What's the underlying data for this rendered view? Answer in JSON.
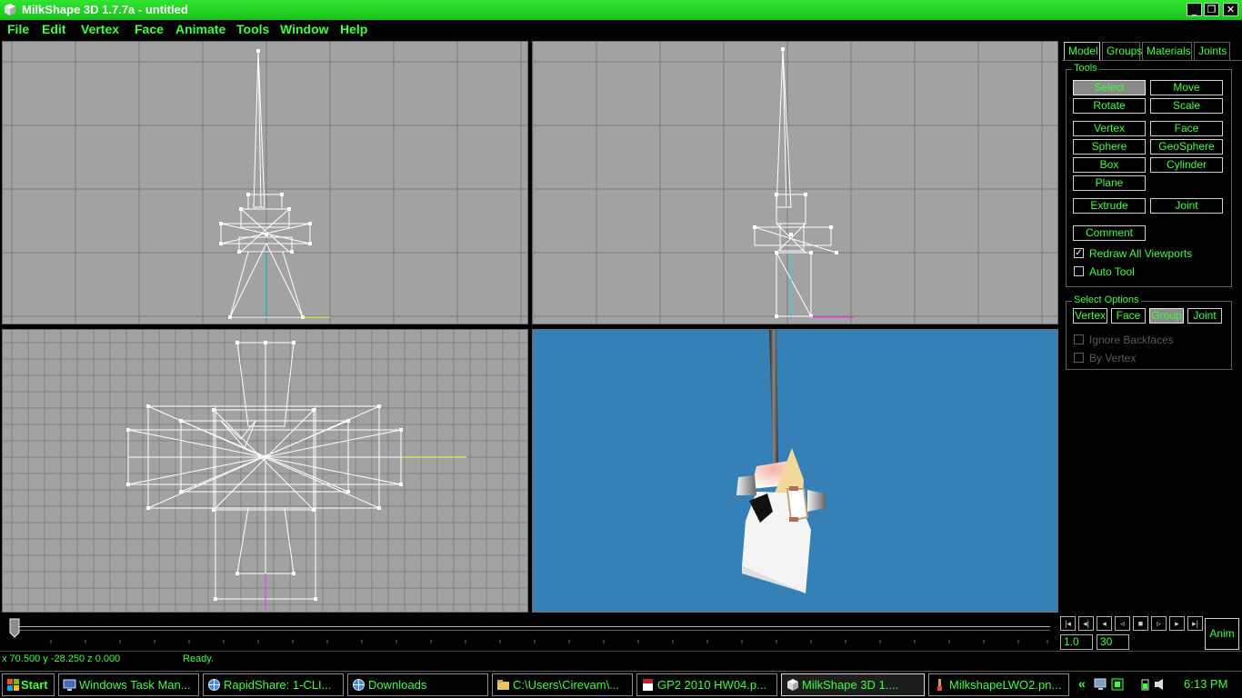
{
  "window": {
    "title": "MilkShape 3D 1.7.7a - untitled"
  },
  "menu": [
    "File",
    "Edit",
    "Vertex",
    "Face",
    "Animate",
    "Tools",
    "Window",
    "Help"
  ],
  "tabs": [
    "Model",
    "Groups",
    "Materials",
    "Joints"
  ],
  "tools": {
    "label": "Tools",
    "buttons": {
      "select": "Select",
      "move": "Move",
      "rotate": "Rotate",
      "scale": "Scale",
      "vertex": "Vertex",
      "face": "Face",
      "sphere": "Sphere",
      "geosphere": "GeoSphere",
      "box": "Box",
      "cylinder": "Cylinder",
      "plane": "Plane",
      "extrude": "Extrude",
      "joint": "Joint",
      "comment": "Comment"
    },
    "redraw_label": "Redraw All Viewports",
    "redraw_checked": true,
    "autotool_label": "Auto Tool",
    "autotool_checked": false
  },
  "select_options": {
    "label": "Select Options",
    "buttons": {
      "vertex": "Vertex",
      "face": "Face",
      "group": "Group",
      "joint": "Joint"
    },
    "ignore_backfaces": "Ignore Backfaces",
    "by_vertex": "By Vertex"
  },
  "timeline": {
    "start": "1.0",
    "end": "30",
    "anim_label": "Anim"
  },
  "status": {
    "coords": "x 70.500 y -28.250 z 0.000",
    "message": "Ready."
  },
  "taskbar": {
    "start": "Start",
    "tasks": [
      "Windows Task Man...",
      "RapidShare: 1-CLI...",
      "Downloads",
      "C:\\Users\\Cirevam\\...",
      "GP2 2010 HW04.p...",
      "MilkShape 3D 1....",
      "MilkshapeLWO2.pn..."
    ],
    "chevron": "«",
    "clock": "6:13 PM"
  },
  "colors": {
    "accent_green": "#3cff3c",
    "titlebar_green": "#22cc22",
    "viewport_gray": "#a2a2a2",
    "perspective_blue": "#3580b6"
  }
}
